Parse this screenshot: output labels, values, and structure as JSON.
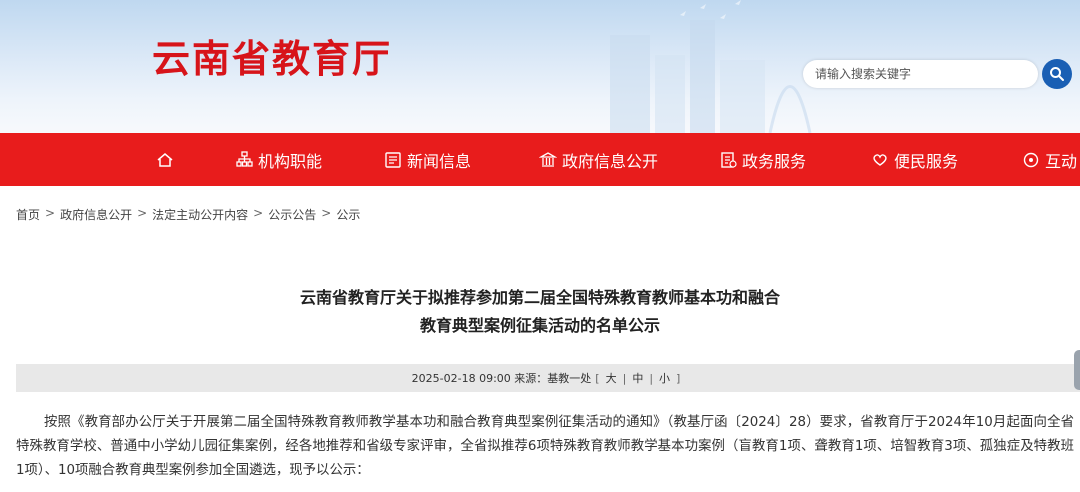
{
  "header": {
    "site_title": "云南省教育厅",
    "search_placeholder": "请输入搜索关键字"
  },
  "nav": {
    "items": [
      {
        "label": "",
        "icon": "home-icon"
      },
      {
        "label": "机构职能",
        "icon": "org-chart-icon"
      },
      {
        "label": "新闻信息",
        "icon": "newspaper-icon"
      },
      {
        "label": "政府信息公开",
        "icon": "government-building-icon"
      },
      {
        "label": "政务服务",
        "icon": "service-document-icon"
      },
      {
        "label": "便民服务",
        "icon": "heart-hand-icon"
      },
      {
        "label": "互动",
        "icon": "interaction-icon"
      }
    ]
  },
  "breadcrumb": [
    "首页",
    "政府信息公开",
    "法定主动公开内容",
    "公示公告",
    "公示"
  ],
  "article": {
    "title_line1": "云南省教育厅关于拟推荐参加第二届全国特殊教育教师基本功和融合",
    "title_line2": "教育典型案例征集活动的名单公示",
    "meta_date": "2025-02-18 09:00",
    "meta_source": "来源：基教一处",
    "font_size_label_large": "大",
    "font_size_label_medium": "中",
    "font_size_label_small": "小",
    "bracket_open": "[",
    "bracket_close": "]",
    "pipe": "|",
    "body": "按照《教育部办公厅关于开展第二届全国特殊教育教师教学基本功和融合教育典型案例征集活动的通知》（教基厅函〔2024〕28）要求，省教育厅于2024年10月起面向全省特殊教育学校、普通中小学幼儿园征集案例，经各地推荐和省级专家评审，全省拟推荐6项特殊教育教师教学基本功案例（盲教育1项、聋教育1项、培智教育3项、孤独症及特教班1项）、10项融合教育典型案例参加全国遴选，现予以公示："
  },
  "colors": {
    "nav_red": "#e81c1c",
    "title_red": "#d7141a",
    "search_blue": "#1a5fb4"
  }
}
